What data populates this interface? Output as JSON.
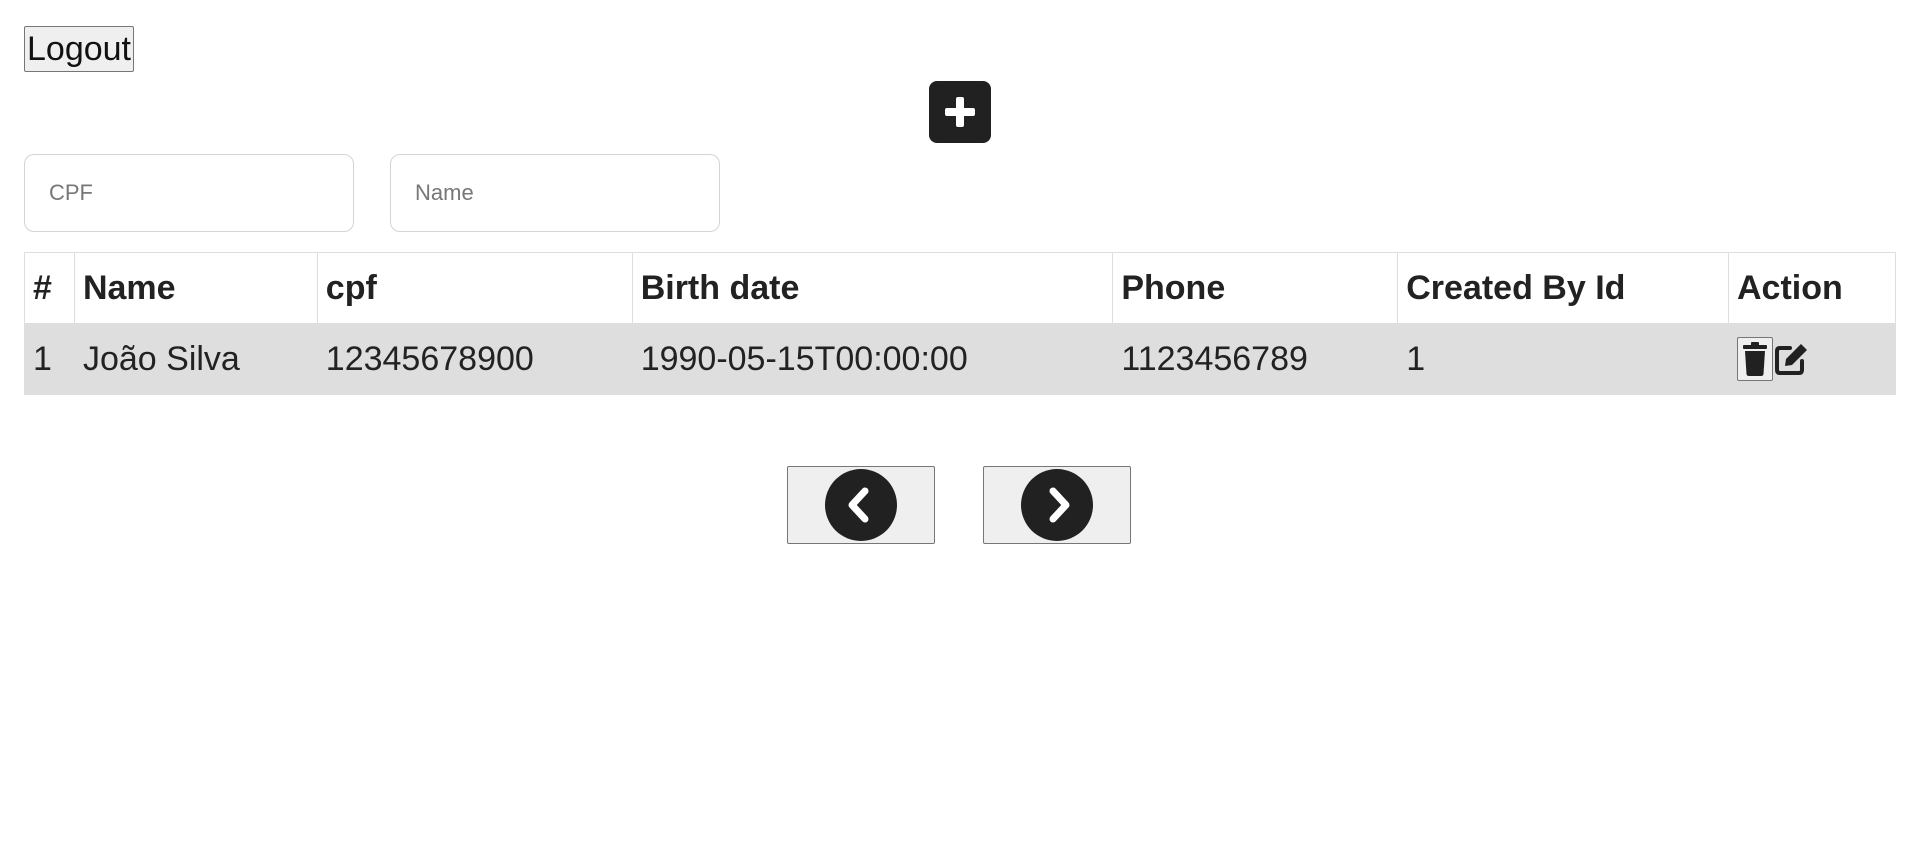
{
  "header": {
    "logout_label": "Logout"
  },
  "filters": {
    "cpf_placeholder": "CPF",
    "name_placeholder": "Name"
  },
  "table": {
    "columns": [
      "#",
      "Name",
      "cpf",
      "Birth date",
      "Phone",
      "Created By Id",
      "Action"
    ],
    "rows": [
      {
        "index": "1",
        "name": "João Silva",
        "cpf": "12345678900",
        "birth_date": "1990-05-15T00:00:00",
        "phone": "1123456789",
        "created_by_id": "1"
      }
    ]
  },
  "icons": {
    "add": "plus-square-icon",
    "delete": "trash-icon",
    "edit": "edit-icon",
    "prev": "chevron-circle-left-icon",
    "next": "chevron-circle-right-icon"
  },
  "colors": {
    "icon_dark": "#212121",
    "row_background": "#dedede",
    "button_background": "#efefef"
  }
}
